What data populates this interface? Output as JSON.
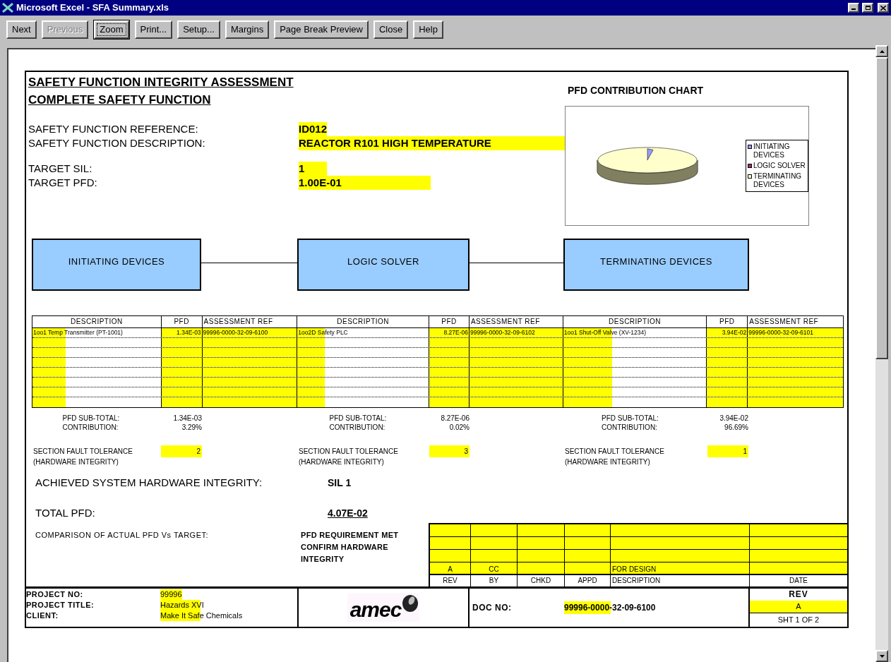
{
  "window": {
    "title": "Microsoft Excel - SFA Summary.xls"
  },
  "toolbar": [
    {
      "label": "Next",
      "disabled": false,
      "selected": false
    },
    {
      "label": "Previous",
      "disabled": true,
      "selected": false
    },
    {
      "label": "Zoom",
      "disabled": false,
      "selected": true
    },
    {
      "label": "Print...",
      "disabled": false,
      "selected": false
    },
    {
      "label": "Setup...",
      "disabled": false,
      "selected": false
    },
    {
      "label": "Margins",
      "disabled": false,
      "selected": false
    },
    {
      "label": "Page Break Preview",
      "disabled": false,
      "selected": false
    },
    {
      "label": "Close",
      "disabled": false,
      "selected": false
    },
    {
      "label": "Help",
      "disabled": false,
      "selected": false
    }
  ],
  "sheet": {
    "titles": [
      "SAFETY FUNCTION INTEGRITY ASSESSMENT",
      "COMPLETE SAFETY FUNCTION"
    ],
    "fields": [
      {
        "label": "SAFETY FUNCTION REFERENCE:",
        "value": "ID012"
      },
      {
        "label": "SAFETY FUNCTION DESCRIPTION:",
        "value": "REACTOR R101 HIGH TEMPERATURE"
      },
      {
        "label": "TARGET SIL:",
        "value": "1"
      },
      {
        "label": "TARGET PFD:",
        "value": "1.00E-01"
      }
    ],
    "chart": {
      "title": "PFD CONTRIBUTION CHART",
      "legend": [
        {
          "label": "INITIATING DEVICES",
          "color": "#9999ff"
        },
        {
          "label": "LOGIC SOLVER",
          "color": "#993366"
        },
        {
          "label": "TERMINATING DEVICES",
          "color": "#ffffcc"
        }
      ]
    },
    "sections": [
      {
        "name": "INITIATING DEVICES",
        "columns": [
          "DESCRIPTION",
          "PFD",
          "ASSESSMENT REF"
        ],
        "rows": [
          [
            "1oo1 Temp Transmitter (PT-1001)",
            "1.34E-03",
            "99996-0000-32-09-6100"
          ]
        ],
        "subtotal_label": "PFD SUB-TOTAL:",
        "subtotal": "1.34E-03",
        "contribution_label": "CONTRIBUTION:",
        "contribution": "3.29%",
        "tolerance_label": "SECTION FAULT TOLERANCE",
        "tolerance_note": "(HARDWARE INTEGRITY)",
        "tolerance": "2"
      },
      {
        "name": "LOGIC SOLVER",
        "columns": [
          "DESCRIPTION",
          "PFD",
          "ASSESSMENT REF"
        ],
        "rows": [
          [
            "1oo2D Safety PLC",
            "8.27E-06",
            "99996-0000-32-09-6102"
          ]
        ],
        "subtotal_label": "PFD SUB-TOTAL:",
        "subtotal": "8.27E-06",
        "contribution_label": "CONTRIBUTION:",
        "contribution": "0.02%",
        "tolerance_label": "SECTION FAULT TOLERANCE",
        "tolerance_note": "(HARDWARE INTEGRITY)",
        "tolerance": "3"
      },
      {
        "name": "TERMINATING DEVICES",
        "columns": [
          "DESCRIPTION",
          "PFD",
          "ASSESSMENT REF"
        ],
        "rows": [
          [
            "1oo1 Shut-Off Valve (XV-1234)",
            "3.94E-02",
            "99996-0000-32-09-6101"
          ]
        ],
        "subtotal_label": "PFD SUB-TOTAL:",
        "subtotal": "3.94E-02",
        "contribution_label": "CONTRIBUTION:",
        "contribution": "96.69%",
        "tolerance_label": "SECTION FAULT TOLERANCE",
        "tolerance_note": "(HARDWARE INTEGRITY)",
        "tolerance": "1"
      }
    ],
    "achieved": {
      "label": "ACHIEVED SYSTEM HARDWARE INTEGRITY:",
      "value": "SIL 1"
    },
    "total": {
      "label": "TOTAL PFD:",
      "value": "4.07E-02"
    },
    "comparison": {
      "label": "COMPARISON OF ACTUAL PFD Vs TARGET:",
      "lines": [
        "PFD REQUIREMENT MET",
        "CONFIRM HARDWARE",
        "INTEGRITY"
      ]
    },
    "revisions": {
      "entries": [
        {
          "rev": "A",
          "by": "CC",
          "description": "FOR DESIGN"
        }
      ],
      "labels": [
        "REV",
        "BY",
        "CHKD",
        "APPD",
        "DESCRIPTION",
        "DATE"
      ]
    },
    "title_block": {
      "fields": [
        {
          "label": "PROJECT NO:",
          "value": "99996"
        },
        {
          "label": "PROJECT TITLE:",
          "value": "Hazards XVI"
        },
        {
          "label": "CLIENT:",
          "value": "Make It Safe Chemicals"
        }
      ],
      "logo": "amec",
      "doc_label": "DOC NO:",
      "doc_no": "99996-0000-32-09-6100",
      "rev_label": "REV",
      "rev": "A",
      "sheet": "SHT 1 OF 2"
    }
  }
}
